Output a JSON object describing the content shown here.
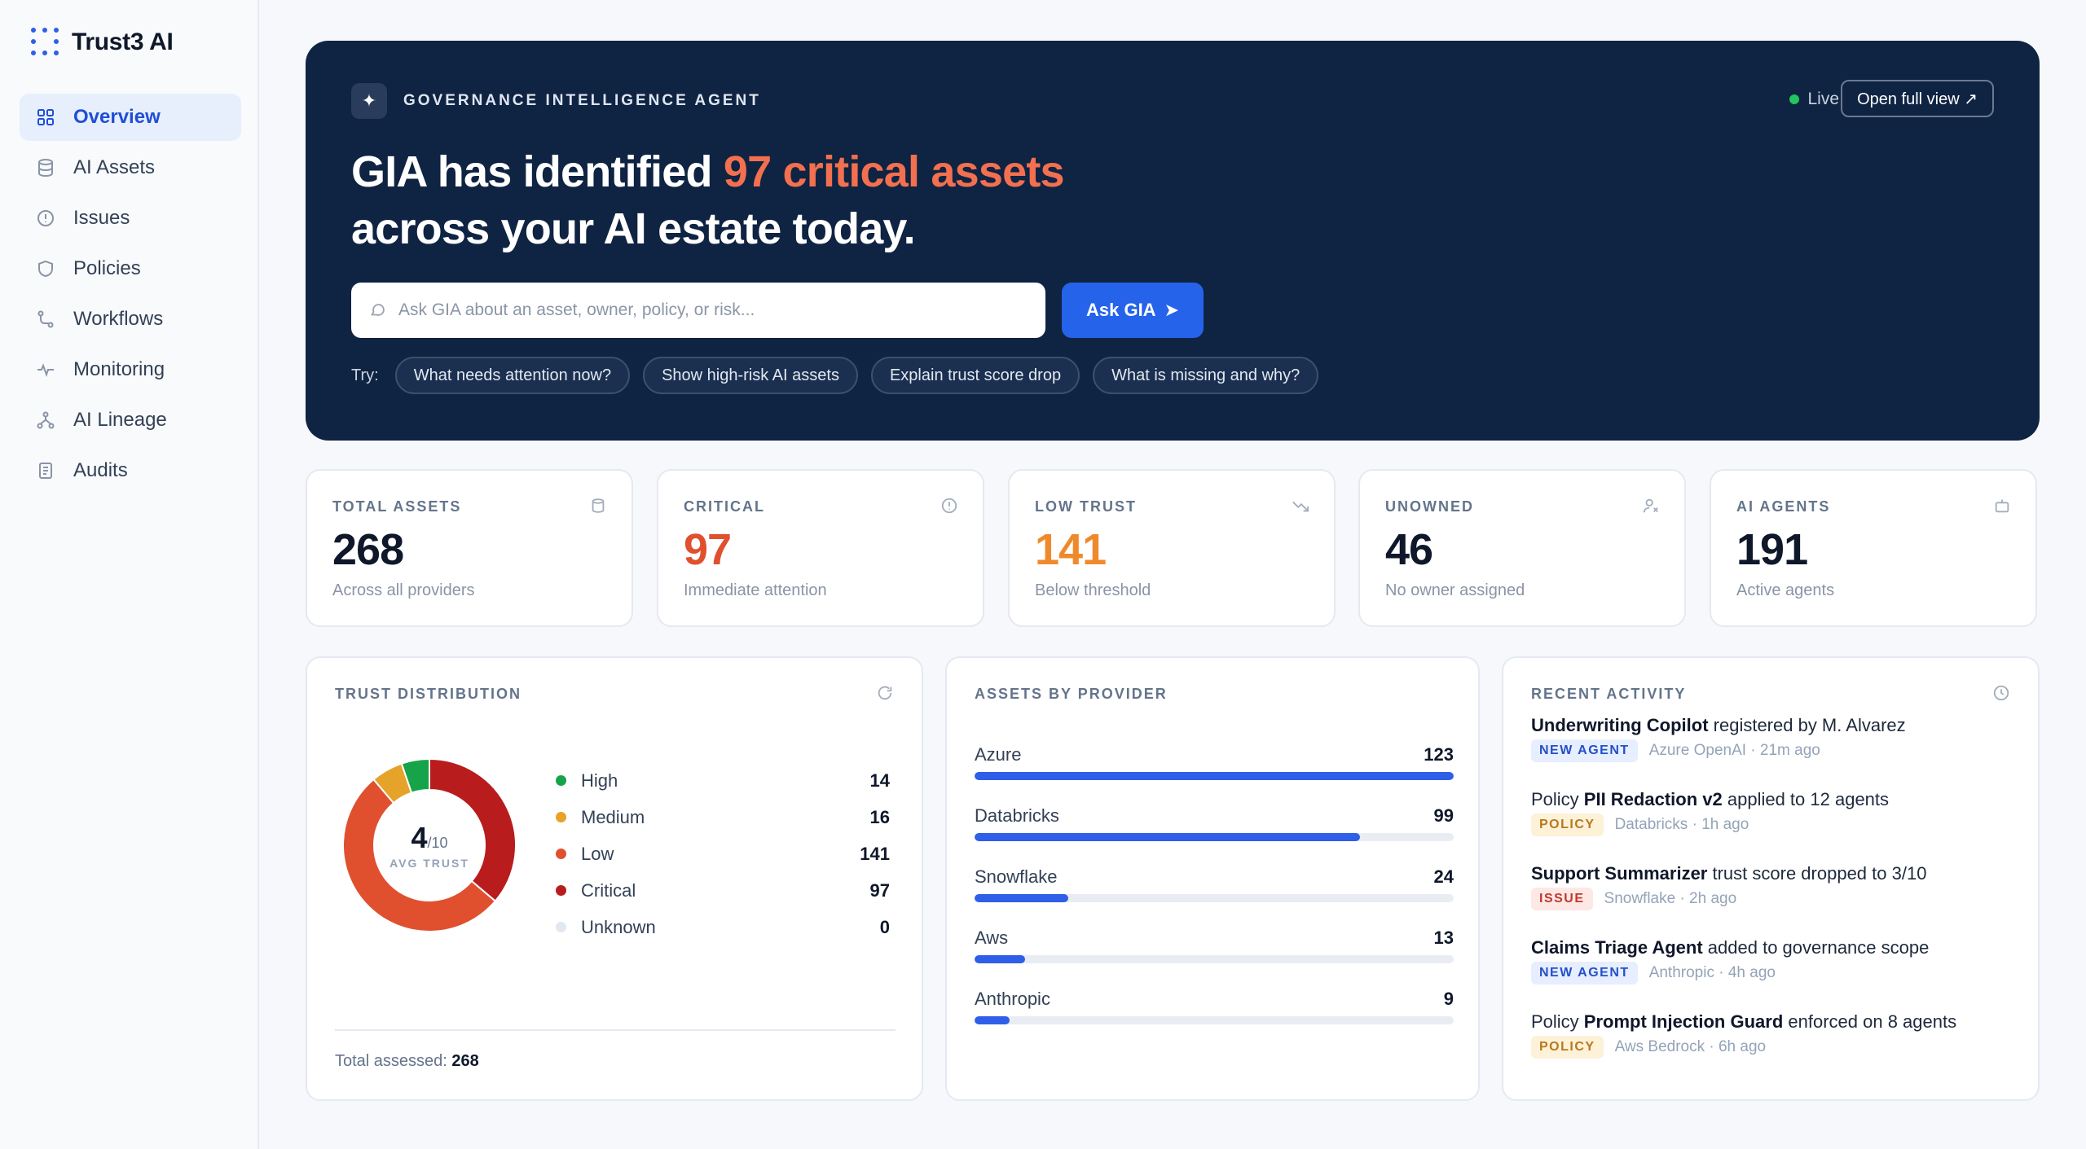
{
  "brand": {
    "name": "Trust3 AI"
  },
  "nav": [
    {
      "label": "Overview",
      "icon": "grid-icon",
      "active": true
    },
    {
      "label": "AI Assets",
      "icon": "database-icon"
    },
    {
      "label": "Issues",
      "icon": "alert-circle-icon"
    },
    {
      "label": "Policies",
      "icon": "shield-icon"
    },
    {
      "label": "Workflows",
      "icon": "route-icon"
    },
    {
      "label": "Monitoring",
      "icon": "pulse-icon"
    },
    {
      "label": "AI Lineage",
      "icon": "lineage-icon"
    },
    {
      "label": "Audits",
      "icon": "document-icon"
    }
  ],
  "hero": {
    "tag": "GOVERNANCE INTELLIGENCE AGENT",
    "live": "Live",
    "open_full": "Open full view ↗",
    "headline_pre": "GIA has identified ",
    "headline_highlight": "97 critical assets",
    "headline_post": "across your AI estate today.",
    "search_placeholder": "Ask GIA about an asset, owner, policy, or risk...",
    "search_value": "",
    "ask_label": "Ask GIA",
    "try_label": "Try:",
    "suggestions": [
      "What needs attention now?",
      "Show high-risk AI assets",
      "Explain trust score drop",
      "What is missing and why?"
    ],
    "colors": {
      "background": "#0f2342",
      "highlight": "#f2704f",
      "live": "#22c55e",
      "button": "#2563eb"
    }
  },
  "stats": [
    {
      "label": "TOTAL ASSETS",
      "value": "268",
      "sub": "Across all providers",
      "icon": "database-icon",
      "color": "#0f172a"
    },
    {
      "label": "CRITICAL",
      "value": "97",
      "sub": "Immediate attention",
      "icon": "alert-circle-icon",
      "color": "#e0502f"
    },
    {
      "label": "LOW TRUST",
      "value": "141",
      "sub": "Below threshold",
      "icon": "trend-down-icon",
      "color": "#ef8a2c"
    },
    {
      "label": "UNOWNED",
      "value": "46",
      "sub": "No owner assigned",
      "icon": "user-x-icon",
      "color": "#0f172a"
    },
    {
      "label": "AI AGENTS",
      "value": "191",
      "sub": "Active agents",
      "icon": "bot-icon",
      "color": "#0f172a"
    }
  ],
  "trust_distribution": {
    "title": "TRUST DISTRIBUTION",
    "icon": "refresh-icon",
    "avg_value": "4",
    "avg_scale": "/10",
    "avg_caption": "AVG TRUST",
    "items": [
      {
        "label": "High",
        "value": 14,
        "color": "#16a34a"
      },
      {
        "label": "Medium",
        "value": 16,
        "color": "#e5a32a"
      },
      {
        "label": "Low",
        "value": 141,
        "color": "#e0502f"
      },
      {
        "label": "Critical",
        "value": 97,
        "color": "#b91c1c"
      },
      {
        "label": "Unknown",
        "value": 0,
        "color": "#e2e8f0"
      }
    ],
    "total_label": "Total assessed:",
    "total_value": "268"
  },
  "providers": {
    "title": "ASSETS BY PROVIDER",
    "max": 123,
    "items": [
      {
        "label": "Azure",
        "value": 123
      },
      {
        "label": "Databricks",
        "value": 99
      },
      {
        "label": "Snowflake",
        "value": 24
      },
      {
        "label": "Aws",
        "value": 13
      },
      {
        "label": "Anthropic",
        "value": 9
      }
    ]
  },
  "activity": {
    "title": "RECENT ACTIVITY",
    "icon": "clock-icon",
    "items": [
      {
        "pre": "",
        "bold": "Underwriting Copilot",
        "post": " registered by M. Alvarez",
        "badge": "NEW AGENT",
        "badge_kind": "new",
        "meta": "Azure OpenAI · 21m ago"
      },
      {
        "pre": "Policy ",
        "bold": "PII Redaction v2",
        "post": " applied to 12 agents",
        "badge": "POLICY",
        "badge_kind": "policy",
        "meta": "Databricks · 1h ago"
      },
      {
        "pre": "",
        "bold": "Support Summarizer",
        "post": " trust score dropped to 3/10",
        "badge": "ISSUE",
        "badge_kind": "issue",
        "meta": "Snowflake · 2h ago"
      },
      {
        "pre": "",
        "bold": "Claims Triage Agent",
        "post": " added to governance scope",
        "badge": "NEW AGENT",
        "badge_kind": "new",
        "meta": "Anthropic · 4h ago"
      },
      {
        "pre": "Policy ",
        "bold": "Prompt Injection Guard",
        "post": " enforced on 8 agents",
        "badge": "POLICY",
        "badge_kind": "policy",
        "meta": "Aws Bedrock · 6h ago"
      }
    ]
  }
}
